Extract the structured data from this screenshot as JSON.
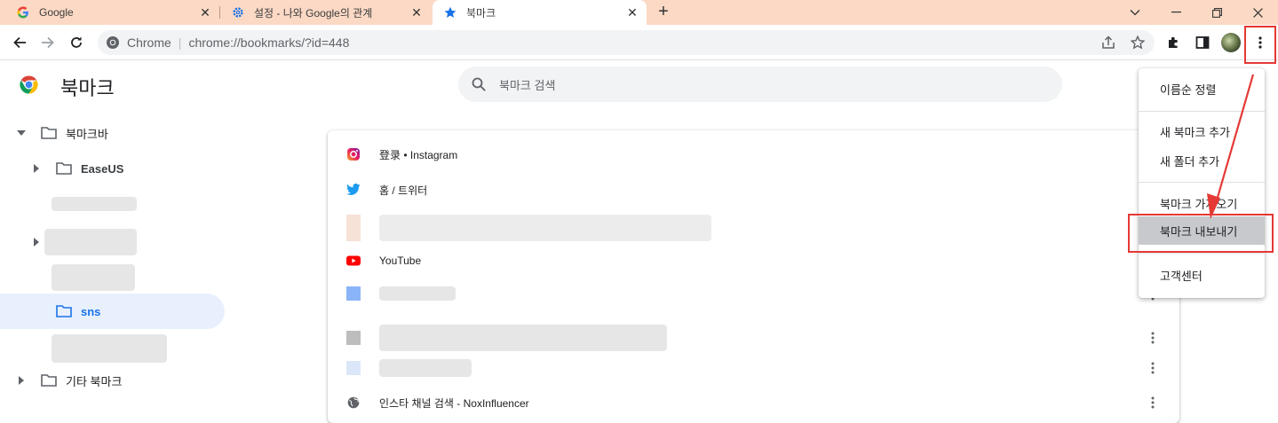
{
  "tabs": [
    {
      "title": "Google",
      "icon": "google-g-icon",
      "active": false
    },
    {
      "title": "설정 - 나와 Google의 관계",
      "icon": "gear-icon",
      "active": false
    },
    {
      "title": "북마크",
      "icon": "star-icon",
      "active": true
    }
  ],
  "toolbar": {
    "scheme_label": "Chrome",
    "url": "chrome://bookmarks/?id=448"
  },
  "page": {
    "title": "북마크",
    "search_placeholder": "북마크 검색"
  },
  "tree": {
    "bookmarks_bar": "북마크바",
    "easeus": "EaseUS",
    "selected": "sns",
    "other": "기타 북마크"
  },
  "bookmarks": [
    {
      "title": "登录 • Instagram",
      "icon": "instagram-icon"
    },
    {
      "title": "홈 / 트위터",
      "icon": "twitter-icon"
    },
    {
      "title": "",
      "icon": "redacted-icon"
    },
    {
      "title": "YouTube",
      "icon": "youtube-icon"
    },
    {
      "title": "",
      "icon": "redacted-icon"
    },
    {
      "title": "",
      "icon": "redacted-icon"
    },
    {
      "title": "",
      "icon": "redacted-icon"
    },
    {
      "title": "인스타 채널 검색 - NoxInfluencer",
      "icon": "globe-icon"
    }
  ],
  "menu": {
    "sort": "이름순 정렬",
    "add_bookmark": "새 북마크 추가",
    "add_folder": "새 폴더 추가",
    "import": "북마크 가져오기",
    "export": "북마크 내보내기",
    "help": "고객센터"
  },
  "colors": {
    "highlight_red": "#e53935",
    "tabstrip": "#fbd9c5",
    "selection": "#e8f0fe",
    "accent_blue": "#1a73e8"
  }
}
